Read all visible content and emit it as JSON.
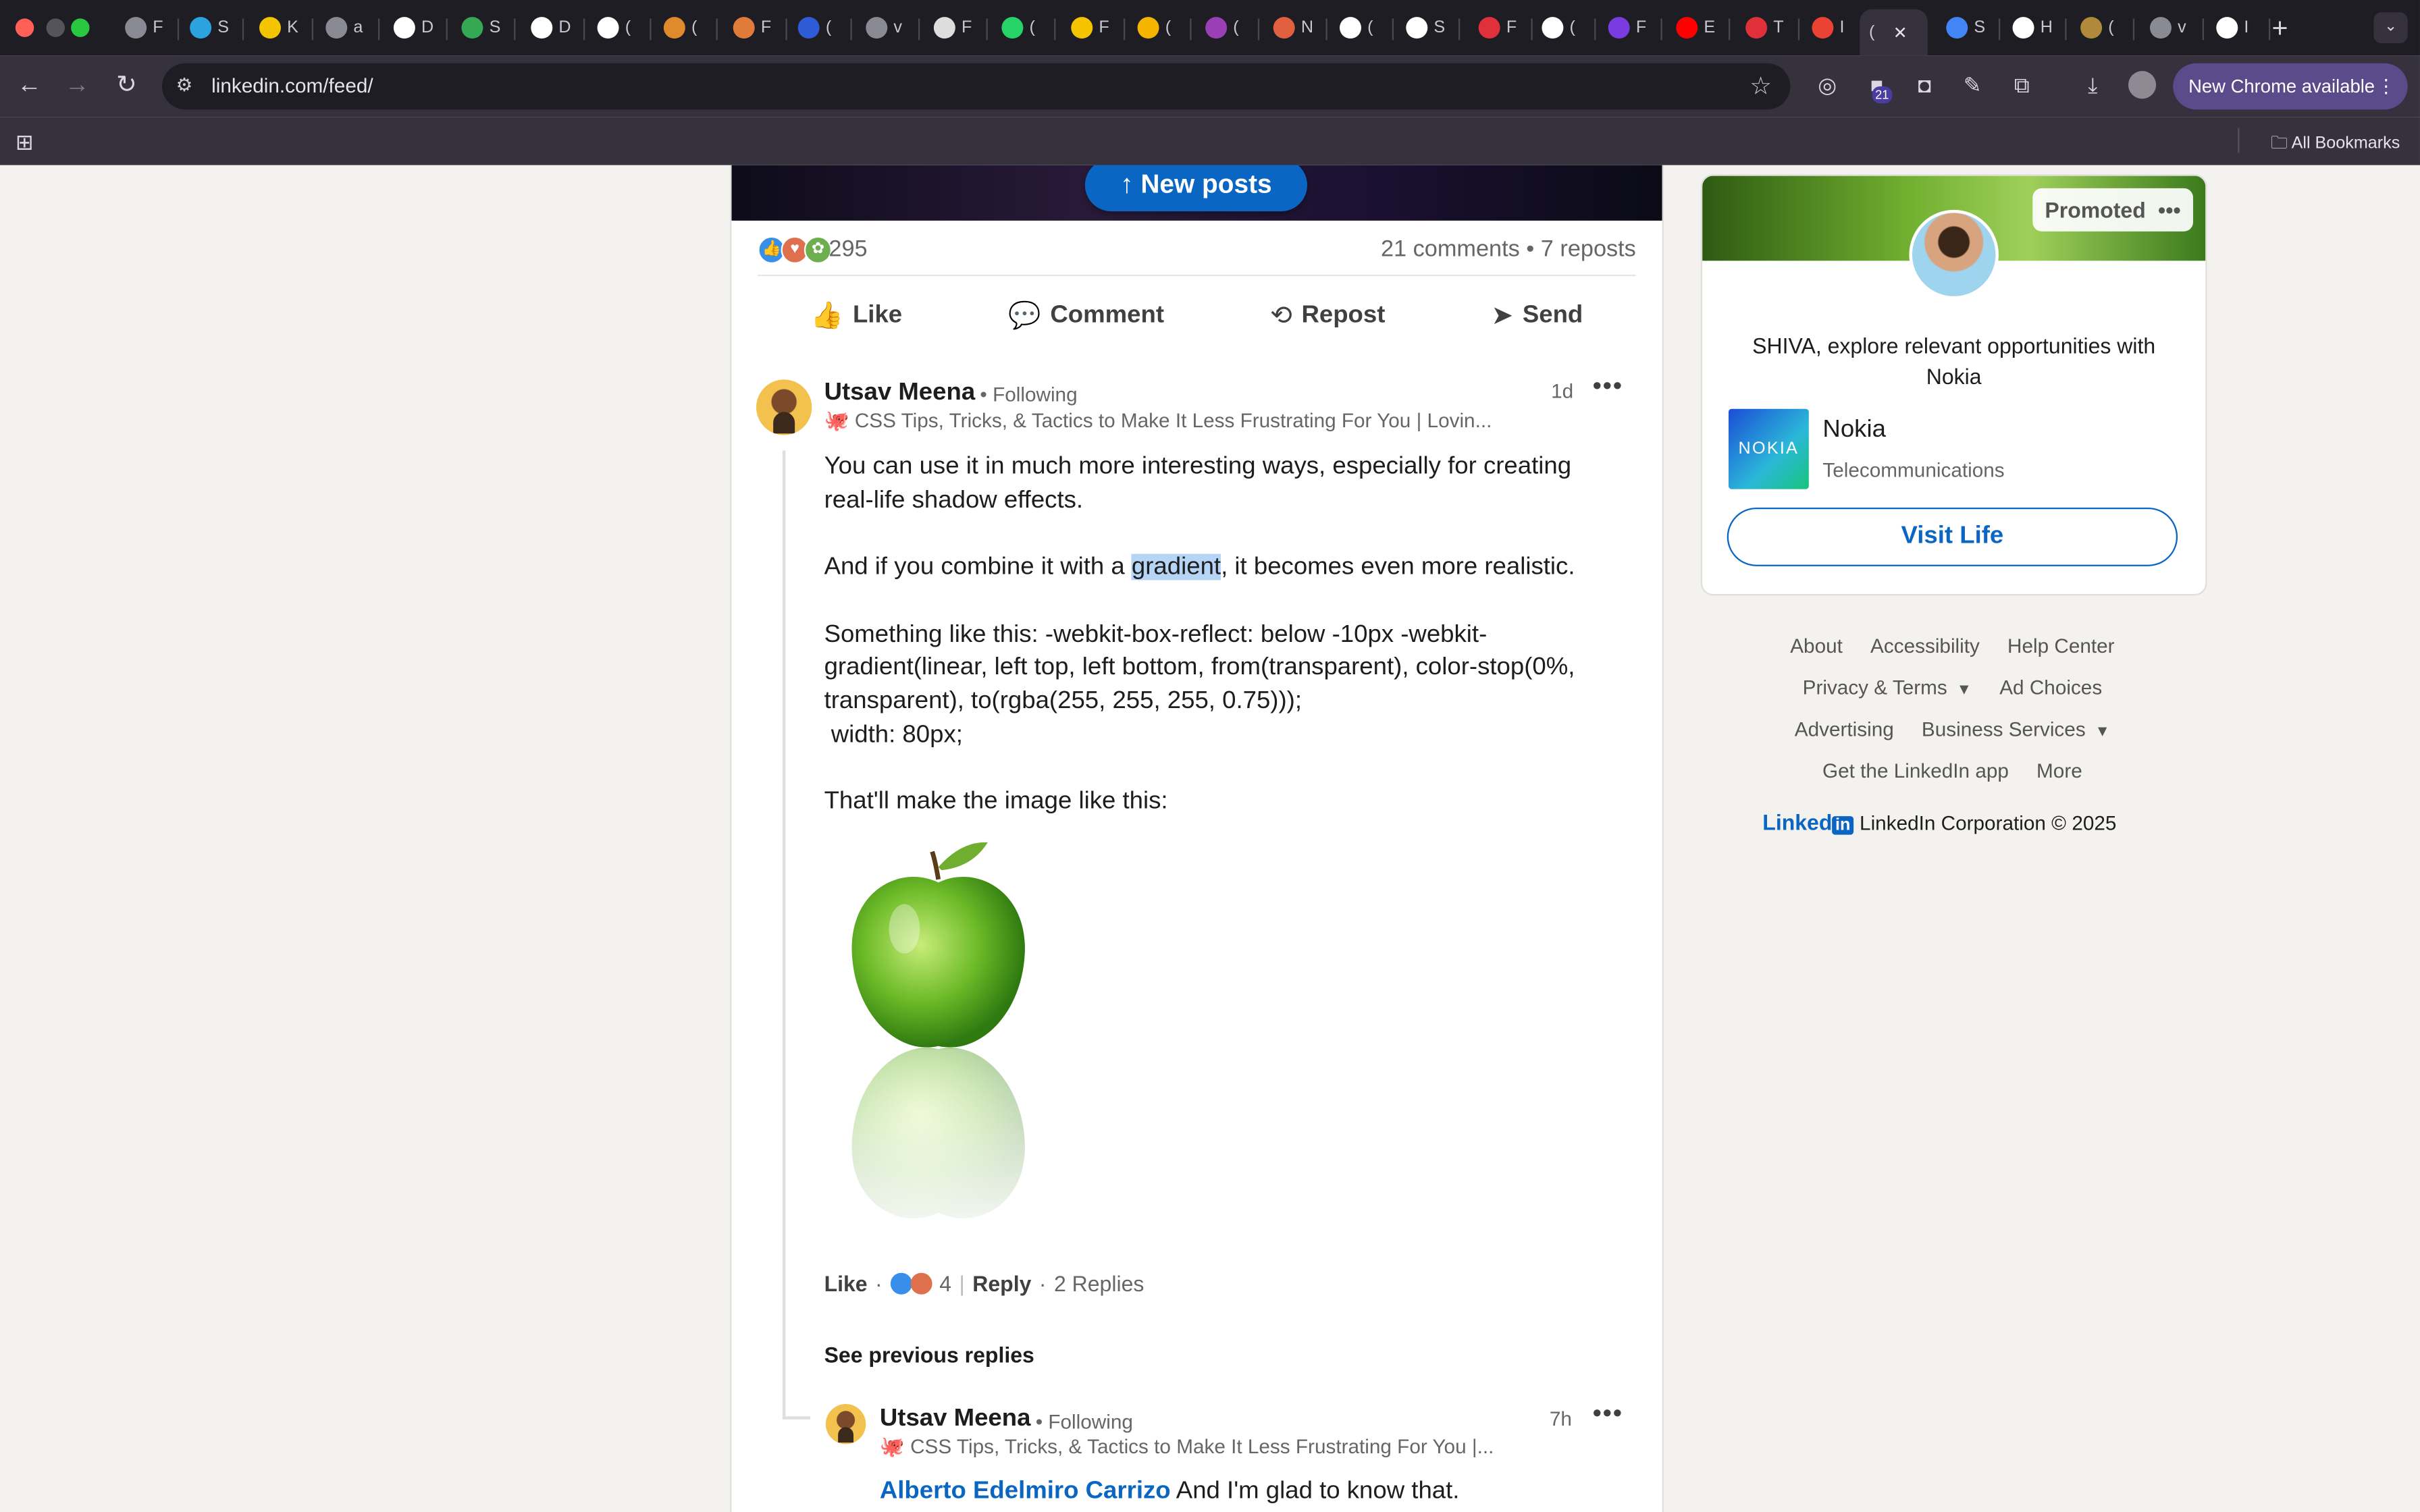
{
  "browser": {
    "url": "linkedin.com/feed/",
    "update_label": "New Chrome available",
    "all_bookmarks": "All Bookmarks",
    "extension_badge": "21",
    "active_tab_label": "(",
    "tabs": [
      {
        "icon": "globe-icon",
        "label": "F",
        "color": "#8a8a95"
      },
      {
        "icon": "telegram-icon",
        "label": "S",
        "color": "#2aa3e0"
      },
      {
        "icon": "k-icon",
        "label": "K",
        "color": "#f4c400"
      },
      {
        "icon": "globe-icon",
        "label": "a",
        "color": "#8a8a95"
      },
      {
        "icon": "circle-icon",
        "label": "D",
        "color": "#ffffff"
      },
      {
        "icon": "maps-icon",
        "label": "S",
        "color": "#34a853"
      },
      {
        "icon": "circle-icon",
        "label": "D",
        "color": "#ffffff"
      },
      {
        "icon": "circle-icon",
        "label": "(",
        "color": "#ffffff"
      },
      {
        "icon": "app-icon",
        "label": "(",
        "color": "#e08a2e"
      },
      {
        "icon": "spark-icon",
        "label": "F",
        "color": "#e07b39"
      },
      {
        "icon": "diamond-icon",
        "label": "(",
        "color": "#2e5bd6"
      },
      {
        "icon": "globe-icon",
        "label": "v",
        "color": "#8a8a95"
      },
      {
        "icon": "doc-icon",
        "label": "F",
        "color": "#dddddd"
      },
      {
        "icon": "whatsapp-icon",
        "label": "(",
        "color": "#25d366"
      },
      {
        "icon": "note-icon",
        "label": "F",
        "color": "#f4c400"
      },
      {
        "icon": "chrome-icon",
        "label": "(",
        "color": "#f4b400"
      },
      {
        "icon": "app-icon",
        "label": "(",
        "color": "#9b3fb6"
      },
      {
        "icon": "cloud-icon",
        "label": "N",
        "color": "#e06040"
      },
      {
        "icon": "openai-icon",
        "label": "(",
        "color": "#ffffff"
      },
      {
        "icon": "openai-icon",
        "label": "S",
        "color": "#ffffff"
      },
      {
        "icon": "flag-icon",
        "label": "F",
        "color": "#e0303a"
      },
      {
        "icon": "openai-icon",
        "label": "(",
        "color": "#ffffff"
      },
      {
        "icon": "b-icon",
        "label": "F",
        "color": "#7a3ce0"
      },
      {
        "icon": "youtube-icon",
        "label": "E",
        "color": "#ff0000"
      },
      {
        "icon": "app-icon",
        "label": "T",
        "color": "#e0303a"
      },
      {
        "icon": "gmail-icon",
        "label": "I",
        "color": "#ea4335"
      },
      {
        "icon": "docs-icon",
        "label": "S",
        "color": "#4285f4"
      },
      {
        "icon": "openai-icon",
        "label": "H",
        "color": "#ffffff"
      },
      {
        "icon": "app-icon",
        "label": "(",
        "color": "#b08a3a"
      },
      {
        "icon": "globe-icon",
        "label": "v",
        "color": "#8a8a95"
      },
      {
        "icon": "github-icon",
        "label": "I",
        "color": "#ffffff"
      }
    ]
  },
  "feed": {
    "new_posts": "New posts",
    "reaction_count": "295",
    "comments_reposts": "21 comments • 7 reposts",
    "actions": [
      {
        "label": "Like",
        "icon": "thumbs-up-icon"
      },
      {
        "label": "Comment",
        "icon": "comment-icon"
      },
      {
        "label": "Repost",
        "icon": "repost-icon"
      },
      {
        "label": "Send",
        "icon": "send-icon"
      }
    ],
    "comment1": {
      "name": "Utsav Meena",
      "following": "• Following",
      "headline": "🐙 CSS Tips, Tricks, & Tactics to Make It Less Frustrating For You | Lovin...",
      "time": "1d",
      "p1": "You can use it in much more interesting ways, especially for creating real-life shadow effects.",
      "p2_before": "And if you combine it with a ",
      "p2_highlight": "gradient",
      "p2_after": ", it becomes even more realistic.",
      "p3": "Something like this: -webkit-box-reflect: below -10px -webkit-gradient(linear, left top, left bottom, from(transparent), color-stop(0%, transparent), to(rgba(255, 255, 255, 0.75)));",
      "p4": " width: 80px;",
      "p5": "That'll make the image like this:",
      "like": "Like",
      "reaction_count": "4",
      "reply": "Reply",
      "replies": "2 Replies"
    },
    "see_previous": "See previous replies",
    "comment2": {
      "name": "Utsav Meena",
      "following": "• Following",
      "headline": "🐙 CSS Tips, Tricks, & Tactics to Make It Less Frustrating For You |...",
      "time": "7h",
      "mention": "Alberto Edelmiro Carrizo",
      "text": " And I'm glad to know that."
    }
  },
  "ad": {
    "promoted": "Promoted",
    "text": "SHIVA, explore relevant opportunities with Nokia",
    "company": "Nokia",
    "company_logo_text": "NOKIA",
    "industry": "Telecommunications",
    "cta": "Visit Life"
  },
  "footer": {
    "about": "About",
    "accessibility": "Accessibility",
    "help": "Help Center",
    "privacy": "Privacy & Terms",
    "adchoices": "Ad Choices",
    "advertising": "Advertising",
    "business": "Business Services",
    "app": "Get the LinkedIn app",
    "more": "More",
    "brand_word": "Linked",
    "brand_in": "in",
    "copyright": "LinkedIn Corporation © 2025"
  },
  "colors": {
    "linkedin_blue": "#0a66c2",
    "highlight": "#b6d4f5",
    "chrome_update": "#5b4b8a"
  }
}
